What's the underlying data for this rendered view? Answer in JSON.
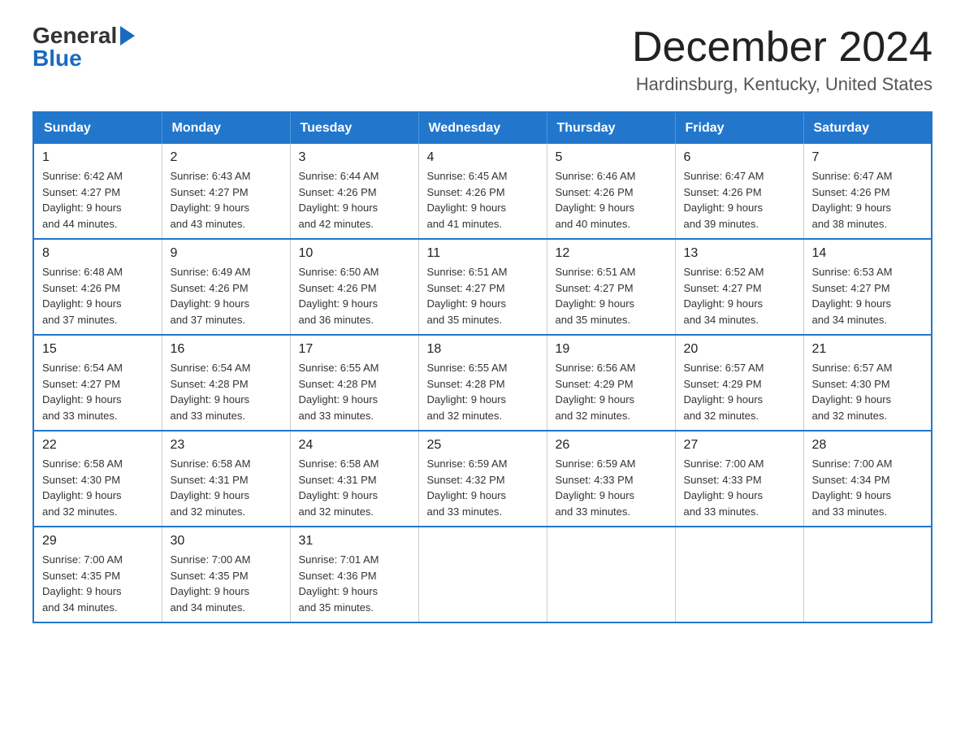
{
  "logo": {
    "general": "General",
    "blue": "Blue"
  },
  "title": "December 2024",
  "subtitle": "Hardinsburg, Kentucky, United States",
  "days_of_week": [
    "Sunday",
    "Monday",
    "Tuesday",
    "Wednesday",
    "Thursday",
    "Friday",
    "Saturday"
  ],
  "weeks": [
    [
      {
        "day": "1",
        "sunrise": "6:42 AM",
        "sunset": "4:27 PM",
        "daylight": "9 hours and 44 minutes."
      },
      {
        "day": "2",
        "sunrise": "6:43 AM",
        "sunset": "4:27 PM",
        "daylight": "9 hours and 43 minutes."
      },
      {
        "day": "3",
        "sunrise": "6:44 AM",
        "sunset": "4:26 PM",
        "daylight": "9 hours and 42 minutes."
      },
      {
        "day": "4",
        "sunrise": "6:45 AM",
        "sunset": "4:26 PM",
        "daylight": "9 hours and 41 minutes."
      },
      {
        "day": "5",
        "sunrise": "6:46 AM",
        "sunset": "4:26 PM",
        "daylight": "9 hours and 40 minutes."
      },
      {
        "day": "6",
        "sunrise": "6:47 AM",
        "sunset": "4:26 PM",
        "daylight": "9 hours and 39 minutes."
      },
      {
        "day": "7",
        "sunrise": "6:47 AM",
        "sunset": "4:26 PM",
        "daylight": "9 hours and 38 minutes."
      }
    ],
    [
      {
        "day": "8",
        "sunrise": "6:48 AM",
        "sunset": "4:26 PM",
        "daylight": "9 hours and 37 minutes."
      },
      {
        "day": "9",
        "sunrise": "6:49 AM",
        "sunset": "4:26 PM",
        "daylight": "9 hours and 37 minutes."
      },
      {
        "day": "10",
        "sunrise": "6:50 AM",
        "sunset": "4:26 PM",
        "daylight": "9 hours and 36 minutes."
      },
      {
        "day": "11",
        "sunrise": "6:51 AM",
        "sunset": "4:27 PM",
        "daylight": "9 hours and 35 minutes."
      },
      {
        "day": "12",
        "sunrise": "6:51 AM",
        "sunset": "4:27 PM",
        "daylight": "9 hours and 35 minutes."
      },
      {
        "day": "13",
        "sunrise": "6:52 AM",
        "sunset": "4:27 PM",
        "daylight": "9 hours and 34 minutes."
      },
      {
        "day": "14",
        "sunrise": "6:53 AM",
        "sunset": "4:27 PM",
        "daylight": "9 hours and 34 minutes."
      }
    ],
    [
      {
        "day": "15",
        "sunrise": "6:54 AM",
        "sunset": "4:27 PM",
        "daylight": "9 hours and 33 minutes."
      },
      {
        "day": "16",
        "sunrise": "6:54 AM",
        "sunset": "4:28 PM",
        "daylight": "9 hours and 33 minutes."
      },
      {
        "day": "17",
        "sunrise": "6:55 AM",
        "sunset": "4:28 PM",
        "daylight": "9 hours and 33 minutes."
      },
      {
        "day": "18",
        "sunrise": "6:55 AM",
        "sunset": "4:28 PM",
        "daylight": "9 hours and 32 minutes."
      },
      {
        "day": "19",
        "sunrise": "6:56 AM",
        "sunset": "4:29 PM",
        "daylight": "9 hours and 32 minutes."
      },
      {
        "day": "20",
        "sunrise": "6:57 AM",
        "sunset": "4:29 PM",
        "daylight": "9 hours and 32 minutes."
      },
      {
        "day": "21",
        "sunrise": "6:57 AM",
        "sunset": "4:30 PM",
        "daylight": "9 hours and 32 minutes."
      }
    ],
    [
      {
        "day": "22",
        "sunrise": "6:58 AM",
        "sunset": "4:30 PM",
        "daylight": "9 hours and 32 minutes."
      },
      {
        "day": "23",
        "sunrise": "6:58 AM",
        "sunset": "4:31 PM",
        "daylight": "9 hours and 32 minutes."
      },
      {
        "day": "24",
        "sunrise": "6:58 AM",
        "sunset": "4:31 PM",
        "daylight": "9 hours and 32 minutes."
      },
      {
        "day": "25",
        "sunrise": "6:59 AM",
        "sunset": "4:32 PM",
        "daylight": "9 hours and 33 minutes."
      },
      {
        "day": "26",
        "sunrise": "6:59 AM",
        "sunset": "4:33 PM",
        "daylight": "9 hours and 33 minutes."
      },
      {
        "day": "27",
        "sunrise": "7:00 AM",
        "sunset": "4:33 PM",
        "daylight": "9 hours and 33 minutes."
      },
      {
        "day": "28",
        "sunrise": "7:00 AM",
        "sunset": "4:34 PM",
        "daylight": "9 hours and 33 minutes."
      }
    ],
    [
      {
        "day": "29",
        "sunrise": "7:00 AM",
        "sunset": "4:35 PM",
        "daylight": "9 hours and 34 minutes."
      },
      {
        "day": "30",
        "sunrise": "7:00 AM",
        "sunset": "4:35 PM",
        "daylight": "9 hours and 34 minutes."
      },
      {
        "day": "31",
        "sunrise": "7:01 AM",
        "sunset": "4:36 PM",
        "daylight": "9 hours and 35 minutes."
      },
      null,
      null,
      null,
      null
    ]
  ],
  "labels": {
    "sunrise": "Sunrise:",
    "sunset": "Sunset:",
    "daylight": "Daylight:"
  }
}
